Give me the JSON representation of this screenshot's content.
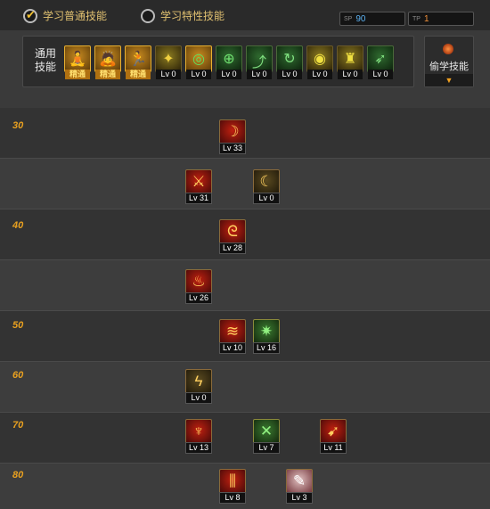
{
  "tabs": {
    "normal": "学习普通技能",
    "special": "学习特性技能"
  },
  "counters": {
    "sp_label": "SP",
    "sp_value": "90",
    "tp_label": "TP",
    "tp_value": "1"
  },
  "general": {
    "label": "通用技能",
    "icons": [
      {
        "level": "精通",
        "icon": "sitting-figure-icon",
        "style": "gold"
      },
      {
        "level": "精通",
        "icon": "kneeling-figure-icon",
        "style": "gold"
      },
      {
        "level": "精通",
        "icon": "running-figure-icon",
        "style": "gold"
      },
      {
        "level": "Lv 0",
        "icon": "wings-icon",
        "style": "yellow"
      },
      {
        "level": "Lv 0",
        "icon": "green-target-icon",
        "style": "gold"
      },
      {
        "level": "Lv 0",
        "icon": "crosshair-icon",
        "style": "green"
      },
      {
        "level": "Lv 0",
        "icon": "leaping-figure-icon",
        "style": "green"
      },
      {
        "level": "Lv 0",
        "icon": "tumbling-figure-icon",
        "style": "green"
      },
      {
        "level": "Lv 0",
        "icon": "eye-icon",
        "style": "yellow"
      },
      {
        "level": "Lv 0",
        "icon": "fortify-figure-icon",
        "style": "yellow"
      },
      {
        "level": "Lv 0",
        "icon": "dashing-figure-icon",
        "style": "green"
      }
    ]
  },
  "steal_skill": {
    "label": "偷学技能"
  },
  "tree": {
    "levels": [
      "30",
      "40",
      "50",
      "60",
      "70",
      "80"
    ],
    "skills": [
      {
        "level": "Lv 33",
        "icon": "flame-slash-icon",
        "style": "red"
      },
      {
        "level": "Lv 31",
        "icon": "sword-strike-icon",
        "style": "red"
      },
      {
        "level": "Lv 0",
        "icon": "crescent-slash-icon",
        "style": "dark"
      },
      {
        "level": "Lv 28",
        "icon": "fire-swirl-icon",
        "style": "red"
      },
      {
        "level": "Lv 26",
        "icon": "fire-warrior-icon",
        "style": "red"
      },
      {
        "level": "Lv 10",
        "icon": "fire-blast-icon",
        "style": "red"
      },
      {
        "level": "Lv 16",
        "icon": "green-burst-icon",
        "style": "greenish"
      },
      {
        "level": "Lv 0",
        "icon": "lightning-blade-icon",
        "style": "dark"
      },
      {
        "level": "Lv 13",
        "icon": "fire-eruption-icon",
        "style": "red"
      },
      {
        "level": "Lv 7",
        "icon": "green-slash-icon",
        "style": "greenish"
      },
      {
        "level": "Lv 11",
        "icon": "bow-icon",
        "style": "red"
      },
      {
        "level": "Lv 8",
        "icon": "fire-pillar-icon",
        "style": "red"
      },
      {
        "level": "Lv 3",
        "icon": "feather-icon",
        "style": "pale"
      }
    ]
  }
}
